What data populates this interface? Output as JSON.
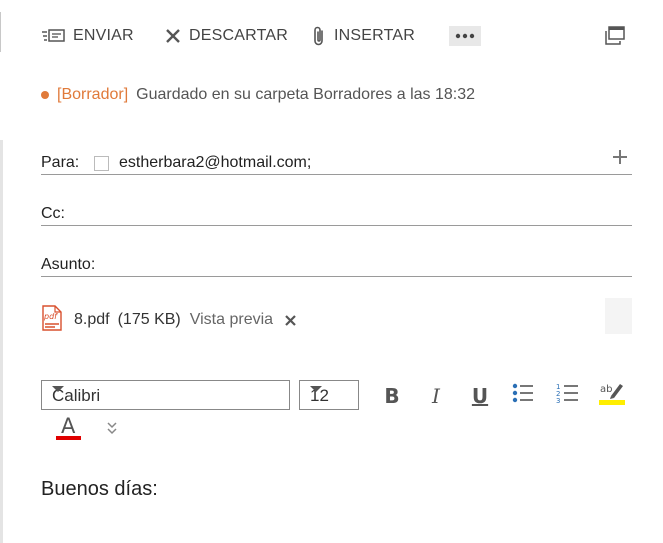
{
  "toolbar": {
    "send_label": "ENVIAR",
    "discard_label": "DESCARTAR",
    "insert_label": "INSERTAR"
  },
  "status": {
    "tag": "[Borrador]",
    "message": "Guardado en su carpeta Borradores a las 18:32"
  },
  "fields": {
    "to_label": "Para:",
    "to_recipient": "estherbara2@hotmail.com;",
    "cc_label": "Cc:",
    "subject_label": "Asunto:"
  },
  "attachment": {
    "name": "8.pdf",
    "size": "(175 KB)",
    "preview_label": "Vista previa"
  },
  "format": {
    "font": "Calibri",
    "size": "12",
    "bold": "B",
    "italic": "I",
    "underline": "U",
    "font_color_letter": "A",
    "font_color": "#e00000",
    "highlight_color": "#ffee00"
  },
  "body": {
    "text": "Buenos días:"
  },
  "colors": {
    "accent": "#e07a3a"
  }
}
